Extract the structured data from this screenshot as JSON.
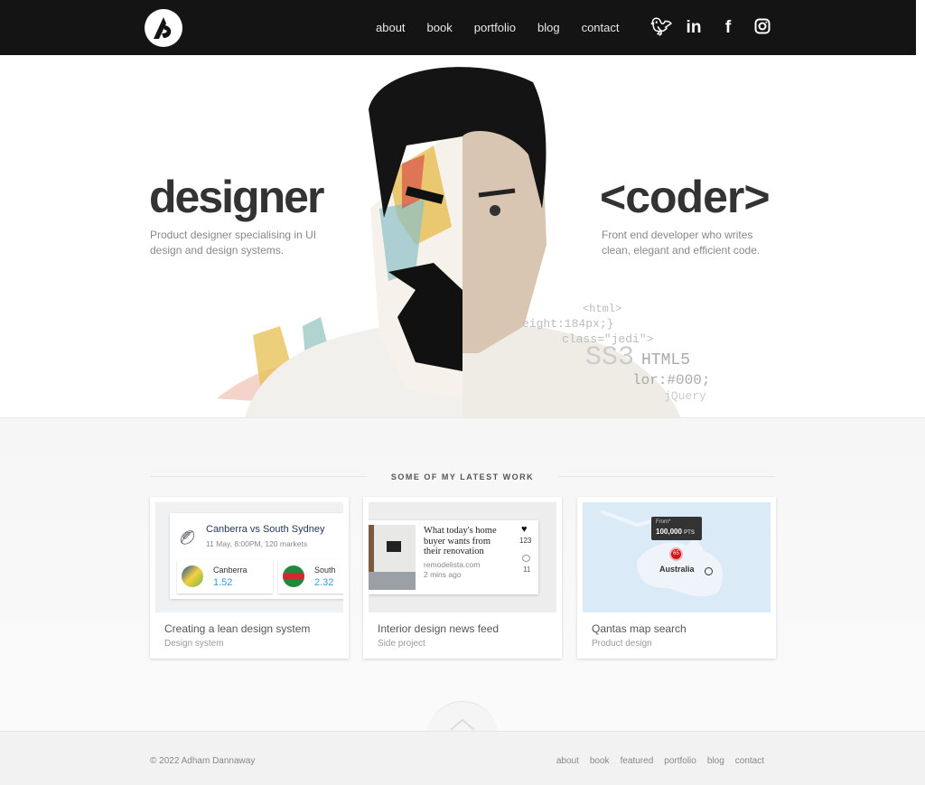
{
  "nav": {
    "logo": "AD",
    "items": [
      "about",
      "book",
      "portfolio",
      "blog",
      "contact"
    ],
    "social": [
      "twitter-icon",
      "linkedin-icon",
      "facebook-icon",
      "instagram-icon"
    ]
  },
  "hero": {
    "left_title": "designer",
    "left_text": "Product designer specialising in UI design and design systems.",
    "right_title": "<coder>",
    "right_text": "Front end developer who writes clean, elegant and efficient code.",
    "code_fragments": [
      "<html>",
      "eight:184px;}",
      "class=\"jedi\">",
      "SS3",
      "HTML5",
      "lor:#000;",
      "jQuery"
    ]
  },
  "work": {
    "title": "SOME OF MY LATEST WORK",
    "cards": [
      {
        "title": "Creating a lean design system",
        "subtitle": "Design system",
        "preview": {
          "match": "Canberra vs South Sydney",
          "meta": "11 May, 8:00PM, 120 markets",
          "team1": "Canberra",
          "odds1": "1.52",
          "team2": "South",
          "odds2": "2.32"
        }
      },
      {
        "title": "Interior design news feed",
        "subtitle": "Side project",
        "preview": {
          "headline": "What today's home buyer wants from their renovation",
          "source": "remodelista.com",
          "time": "2 mins ago",
          "likes": "123",
          "comments": "11"
        }
      },
      {
        "title": "Qantas map search",
        "subtitle": "Product design",
        "preview": {
          "from": "From*",
          "points": "100,000",
          "pts": "PTS",
          "badge": "65",
          "label": "Australia"
        }
      }
    ]
  },
  "footer": {
    "copyright": "© 2022 Adham Dannaway",
    "items": [
      "about",
      "book",
      "featured",
      "portfolio",
      "blog",
      "contact"
    ]
  }
}
